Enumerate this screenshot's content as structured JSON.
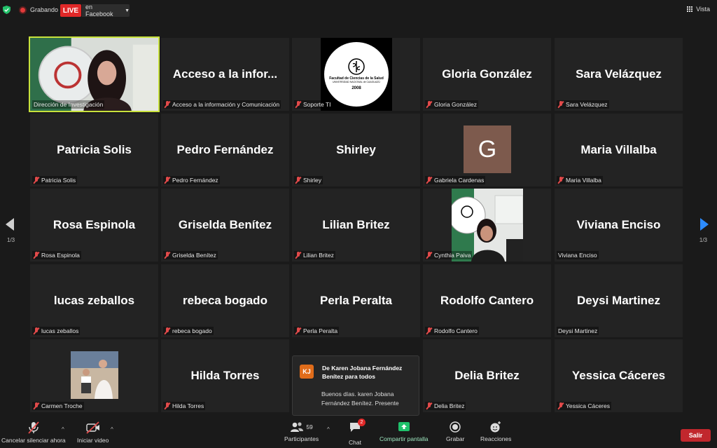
{
  "top": {
    "recording_label": "Grabando",
    "live_label": "LIVE",
    "live_target": "en Facebook",
    "view_label": "Vista"
  },
  "tiles": [
    {
      "big": "",
      "label": "Dirección de Investigación",
      "muted": false,
      "kind": "video-woman",
      "active": true
    },
    {
      "big": "Acceso a la infor...",
      "label": "Acceso a la información y Comunicación",
      "muted": true
    },
    {
      "big": "",
      "label": "Soporte TI",
      "muted": true,
      "kind": "logo"
    },
    {
      "big": "Gloria González",
      "label": "Gloria González",
      "muted": true
    },
    {
      "big": "Sara Velázquez",
      "label": "Sara Velázquez",
      "muted": true
    },
    {
      "big": "Patricia Solis",
      "label": "Patricia Solis",
      "muted": true
    },
    {
      "big": "Pedro Fernández",
      "label": "Pedro Fernández",
      "muted": true
    },
    {
      "big": "Shirley",
      "label": "Shirley",
      "muted": true
    },
    {
      "big": "",
      "label": "Gabriela Cardenas",
      "muted": true,
      "kind": "avatar",
      "avatar_letter": "G"
    },
    {
      "big": "Maria Villalba",
      "label": "Maria Villalba",
      "muted": true
    },
    {
      "big": "Rosa Espinola",
      "label": "Rosa Espinola",
      "muted": true
    },
    {
      "big": "Griselda Benítez",
      "label": "Griselda Benítez",
      "muted": true
    },
    {
      "big": "Lilian Britez",
      "label": "Lilian Britez",
      "muted": true
    },
    {
      "big": "",
      "label": "Cynthia Paiva",
      "muted": true,
      "kind": "video-office"
    },
    {
      "big": "Viviana Enciso",
      "label": "Viviana Enciso",
      "muted": false
    },
    {
      "big": "lucas zeballos",
      "label": "lucas zeballos",
      "muted": true
    },
    {
      "big": "rebeca bogado",
      "label": "rebeca bogado",
      "muted": true
    },
    {
      "big": "Perla Peralta",
      "label": "Perla Peralta",
      "muted": true
    },
    {
      "big": "Rodolfo Cantero",
      "label": "Rodolfo Cantero",
      "muted": true
    },
    {
      "big": "Deysi Martinez",
      "label": "Deysi Martinez",
      "muted": false
    },
    {
      "big": "",
      "label": "Carmen Troche",
      "muted": true,
      "kind": "photo"
    },
    {
      "big": "Hilda Torres",
      "label": "Hilda Torres",
      "muted": true
    },
    {
      "big": "",
      "label": "",
      "muted": false,
      "kind": "hidden"
    },
    {
      "big": "Delia  Britez",
      "label": "Delia  Britez",
      "muted": true
    },
    {
      "big": "Yessica Cáceres",
      "label": "Yessica Cáceres",
      "muted": true
    }
  ],
  "logo": {
    "line1": "Facultad de Ciencias de la Salud",
    "line2": "UNIVERSIDAD NACIONAL de CAAGUAZÚ",
    "year": "2008"
  },
  "pager": {
    "left": "1/3",
    "right": "1/3"
  },
  "chat_popup": {
    "initials": "KJ",
    "from": "De Karen Jobana Fernández Benítez para todos",
    "message": "Buenos días. karen Jobana Fernández Benítez. Presente"
  },
  "toolbar": {
    "unmute": "Cancelar silenciar ahora",
    "video": "Iniciar video",
    "participants": "Participantes",
    "participants_count": "59",
    "chat": "Chat",
    "chat_badge": "2",
    "share": "Compartir pantalla",
    "record": "Grabar",
    "reactions": "Reacciones",
    "leave": "Salir"
  },
  "colors": {
    "accent_live": "#e02828",
    "active_border": "#c8e23c",
    "share_green": "#1fc16b",
    "nav_blue": "#2d8cff",
    "leave_red": "#c1272d"
  }
}
